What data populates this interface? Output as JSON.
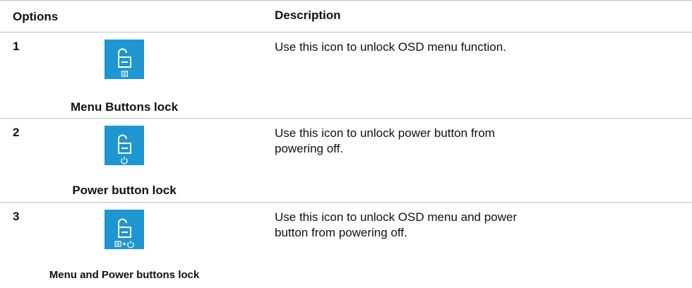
{
  "header": {
    "options": "Options",
    "description": "Description"
  },
  "rows": [
    {
      "number": "1",
      "caption": "Menu Buttons lock",
      "description": "Use this icon to unlock OSD menu function.",
      "icon": "unlock-menu-icon"
    },
    {
      "number": "2",
      "caption": "Power button lock",
      "description": "Use this icon to unlock power button from powering off.",
      "icon": "unlock-power-icon"
    },
    {
      "number": "3",
      "caption": "Menu and Power buttons lock",
      "description": "Use this icon to unlock OSD menu and power button from powering off.",
      "icon": "unlock-menu-power-icon"
    }
  ],
  "colors": {
    "tile": "#1e96d2",
    "glyph": "#ffffff",
    "rule": "#bdbdbd"
  }
}
